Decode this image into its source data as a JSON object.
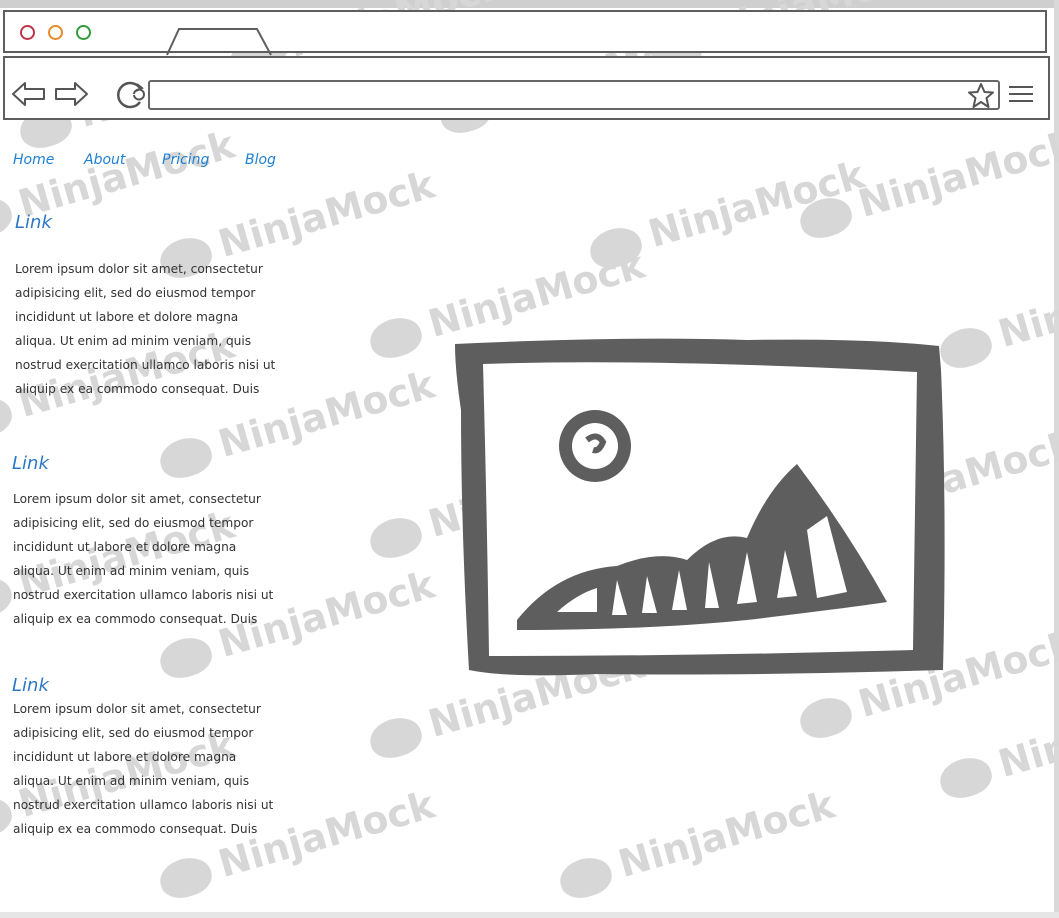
{
  "colors": {
    "traffic_red": "#c0344a",
    "traffic_orange": "#e58a2b",
    "traffic_green": "#2f9b3a",
    "link_blue": "#1f7fd1",
    "sketch_gray": "#5e5e5e"
  },
  "browser": {
    "back_icon": "arrow-left-outline",
    "forward_icon": "arrow-right-outline",
    "reload_icon": "reload-outline",
    "address_value": "",
    "bookmark_icon": "star-outline",
    "menu_icon": "hamburger"
  },
  "nav": {
    "items": [
      {
        "label": "Home"
      },
      {
        "label": "About"
      },
      {
        "label": "Pricing"
      },
      {
        "label": "Blog"
      }
    ]
  },
  "content": {
    "sections": [
      {
        "link": "Link",
        "lines": [
          "Lorem ipsum dolor sit amet, consectetur",
          "adipisicing elit, sed do eiusmod tempor",
          "incididunt ut labore et dolore magna",
          "aliqua. Ut enim ad minim veniam, quis",
          "nostrud exercitation ullamco laboris nisi ut",
          "aliquip ex ea commodo consequat. Duis"
        ]
      },
      {
        "link": "Link",
        "lines": [
          "Lorem ipsum dolor sit amet, consectetur",
          "adipisicing elit, sed do eiusmod tempor",
          "incididunt ut labore et dolore magna",
          "aliqua. Ut enim ad minim veniam, quis",
          "nostrud exercitation ullamco laboris nisi ut",
          "aliquip ex ea commodo consequat. Duis"
        ]
      },
      {
        "link": "Link",
        "lines": [
          "Lorem ipsum dolor sit amet, consectetur",
          "adipisicing elit, sed do eiusmod tempor",
          "incididunt ut labore et dolore magna",
          "aliqua. Ut enim ad minim veniam, quis",
          "nostrud exercitation ullamco laboris nisi ut",
          "aliquip ex ea commodo consequat. Duis"
        ]
      }
    ],
    "image_icon": "image-placeholder"
  },
  "watermark": {
    "text": "NinjaMock"
  }
}
